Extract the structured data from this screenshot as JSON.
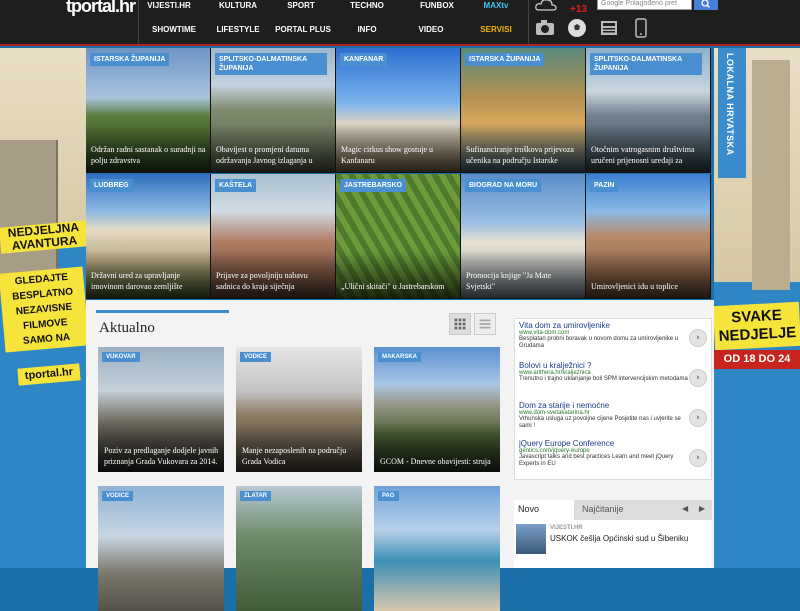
{
  "header": {
    "logo": "tportal.hr",
    "nav_top": [
      "VIJESTI.HR",
      "KULTURA",
      "SPORT",
      "TECHNO",
      "FUNBOX",
      "MAXtv"
    ],
    "nav_bottom": [
      "SHOWTIME",
      "LIFESTYLE",
      "PORTAL PLUS",
      "INFO",
      "VIDEO",
      "SERVISI"
    ],
    "temperature": "+13",
    "search_placeholder": "Prilagođeno pret",
    "search_brand": "Google"
  },
  "colors": {
    "accent": "#3b8ccc",
    "topbar": "#1e1e1e",
    "red": "#b51f1f",
    "maxtv": "#3fc3f5",
    "servisi": "#f5b400"
  },
  "top_icons": [
    "camera-icon",
    "soccer-ball-icon",
    "newspaper-icon",
    "mobile-phone-icon"
  ],
  "ad_left": {
    "line1": "NEDJELJNA",
    "line2": "AVANTURA",
    "promo": [
      "GLEDAJTE",
      "BESPLATNO",
      "NEZAVISNE",
      "FILMOVE",
      "SAMO NA"
    ],
    "brand": "tportal.hr"
  },
  "ad_right": {
    "line1": "SVAKE",
    "line2": "NEDJELJE",
    "dates": "OD 18 DO 24"
  },
  "lokalna": "LOKALNA HRVATSKA",
  "tiles": [
    {
      "tag": "ISTARSKA ŽUPANIJA",
      "title": "Održan radni sastanak o suradnji na polju zdravstva"
    },
    {
      "tag": "SPLITSKO-DALMATINSKA ŽUPANIJA",
      "title": "Obavijest o promjeni datuma održavanja Javnog izlaganja u"
    },
    {
      "tag": "KANFANAR",
      "title": "Magic cirkus show gostuje u Kanfanaru"
    },
    {
      "tag": "ISTARSKA ŽUPANIJA",
      "title": "Sufinanciranje troškova prijevoza učenika na području Istarske"
    },
    {
      "tag": "SPLITSKO-DALMATINSKA ŽUPANIJA",
      "title": "Otočnim vatrogasnim društvima uručeni prijenosni uređaji za"
    },
    {
      "tag": "LUDBREG",
      "title": "Državni ured za upravljanje imovinom darovao zemljište"
    },
    {
      "tag": "KAŠTELA",
      "title": "Prijave za povoljniju nabavu sadnica do kraja siječnja"
    },
    {
      "tag": "JASTREBARSKO",
      "title": "„Ulični skitači\" u Jastrebarskom"
    },
    {
      "tag": "BIOGRAD NA MORU",
      "title": "Promocija knjige \"Ja Mate Svjetski\""
    },
    {
      "tag": "PAZIN",
      "title": "Umirovljenici idu u toplice"
    }
  ],
  "aktualno": {
    "heading": "Aktualno",
    "cards": [
      {
        "tag": "VUKOVAR",
        "title": "Poziv za predlaganje dodjele javnih priznanja Grada Vukovara za 2014."
      },
      {
        "tag": "VODICE",
        "title": "Manje nezaposlenih na području Grada Vodica"
      },
      {
        "tag": "MAKARSKA",
        "title": "GCOM - Dnevne obavijesti: struja"
      },
      {
        "tag": "VODICE",
        "title": ""
      },
      {
        "tag": "ZLATAR",
        "title": ""
      },
      {
        "tag": "PAG",
        "title": ""
      }
    ]
  },
  "ads": [
    {
      "title": "Vita dom za umirovljenike",
      "url": "www.vita-dom.com",
      "desc": "Besplatan probni boravak u novom domu za umirovljenike u Grudama"
    },
    {
      "title": "Bolovi u kralježnici ?",
      "url": "www.arithera.hr/kraljeznica",
      "desc": "Trenutno i trajno uklanjanje boli SPM intervencijskim metodama !"
    },
    {
      "title": "Dom za starije i nemoćne",
      "url": "www.dom-svetakatarina.hr",
      "desc": "Vrhunska usluga uz povoljne cijene Posjetite nas i uvjerite se sami !"
    },
    {
      "title": "jQuery Europe Conference",
      "url": "gentics.com/jquery-europe",
      "desc": "Javascript talks and best practices Learn and meet jQuery Experts in EU"
    }
  ],
  "news_tabs": {
    "tab1": "Novo",
    "tab2": "Najčitanije"
  },
  "news": [
    {
      "source": "VIJESTI.HR",
      "title": "USKOK češlja Općinski sud u Šibeniku"
    }
  ]
}
